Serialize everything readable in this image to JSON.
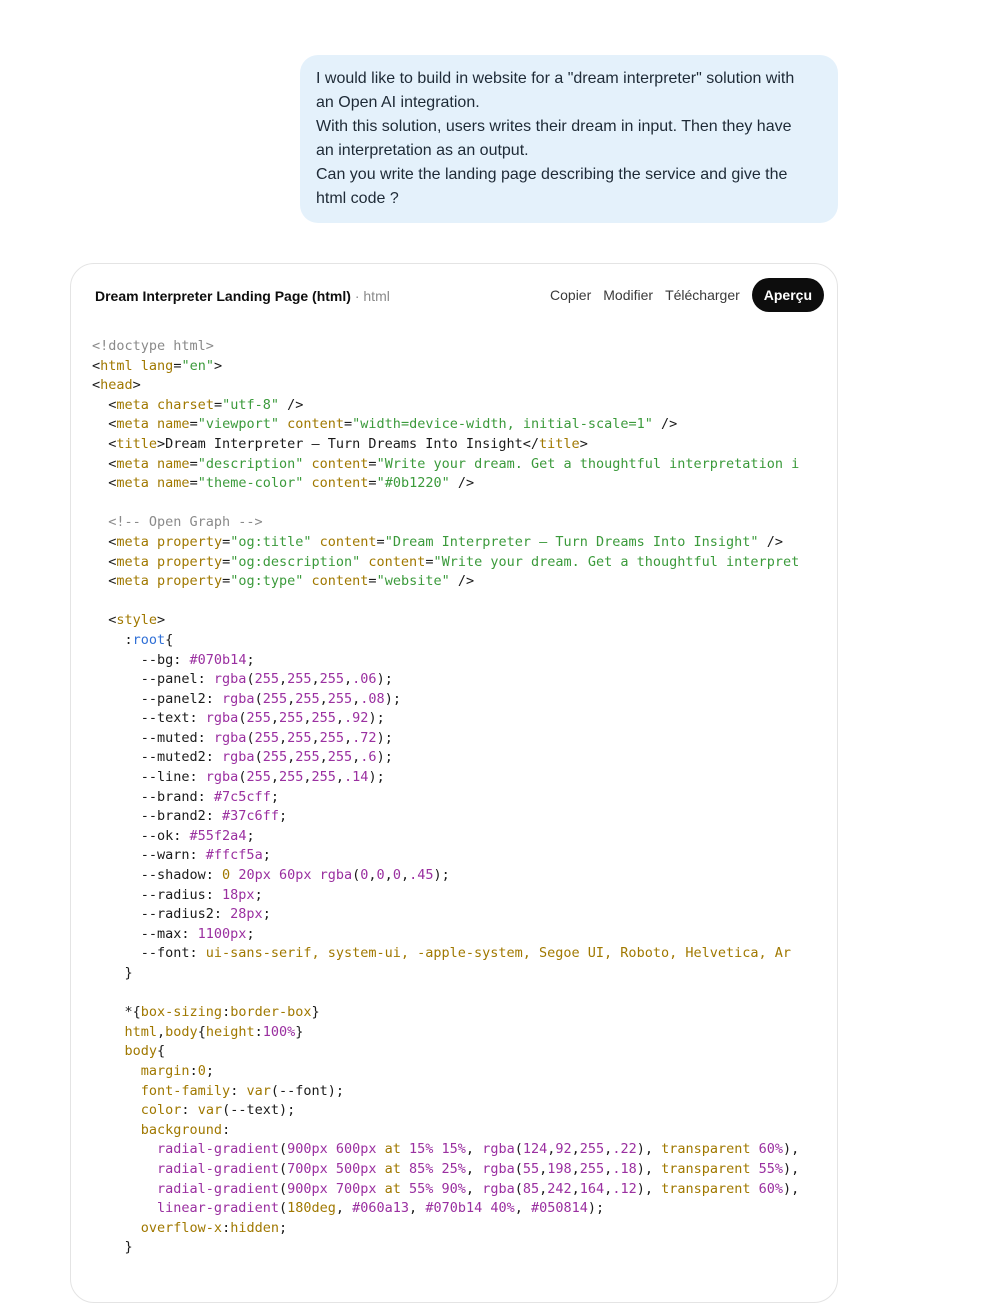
{
  "user_message": {
    "lines": [
      "I would like to build in website for a \"dream interpreter\" solution with",
      "an Open AI integration.",
      "With this solution, users writes their dream in input. Then they have",
      "an interpretation as an output.",
      "Can you write the landing page describing the service and give the",
      "html code ?"
    ]
  },
  "code_card": {
    "title": "Dream Interpreter Landing Page (html)",
    "separator": " · ",
    "language": "html",
    "actions": {
      "copy": "Copier",
      "edit": "Modifier",
      "download": "Télécharger",
      "preview": "Aperçu"
    }
  },
  "code_lines": [
    [
      [
        "com",
        "<!doctype html>"
      ]
    ],
    [
      [
        "plain",
        "<"
      ],
      [
        "tag",
        "html"
      ],
      [
        "plain",
        " "
      ],
      [
        "attr",
        "lang"
      ],
      [
        "plain",
        "="
      ],
      [
        "str",
        "\"en\""
      ],
      [
        "plain",
        ">"
      ]
    ],
    [
      [
        "plain",
        "<"
      ],
      [
        "tag",
        "head"
      ],
      [
        "plain",
        ">"
      ]
    ],
    [
      [
        "plain",
        "  <"
      ],
      [
        "tag",
        "meta"
      ],
      [
        "plain",
        " "
      ],
      [
        "attr",
        "charset"
      ],
      [
        "plain",
        "="
      ],
      [
        "str",
        "\"utf-8\""
      ],
      [
        "plain",
        " />"
      ]
    ],
    [
      [
        "plain",
        "  <"
      ],
      [
        "tag",
        "meta"
      ],
      [
        "plain",
        " "
      ],
      [
        "attr",
        "name"
      ],
      [
        "plain",
        "="
      ],
      [
        "str",
        "\"viewport\""
      ],
      [
        "plain",
        " "
      ],
      [
        "attr",
        "content"
      ],
      [
        "plain",
        "="
      ],
      [
        "str",
        "\"width=device-width, initial-scale=1\""
      ],
      [
        "plain",
        " />"
      ]
    ],
    [
      [
        "plain",
        "  <"
      ],
      [
        "tag",
        "title"
      ],
      [
        "plain",
        ">Dream Interpreter — Turn Dreams Into Insight</"
      ],
      [
        "tag",
        "title"
      ],
      [
        "plain",
        ">"
      ]
    ],
    [
      [
        "plain",
        "  <"
      ],
      [
        "tag",
        "meta"
      ],
      [
        "plain",
        " "
      ],
      [
        "attr",
        "name"
      ],
      [
        "plain",
        "="
      ],
      [
        "str",
        "\"description\""
      ],
      [
        "plain",
        " "
      ],
      [
        "attr",
        "content"
      ],
      [
        "plain",
        "="
      ],
      [
        "str",
        "\"Write your dream. Get a thoughtful interpretation i"
      ]
    ],
    [
      [
        "plain",
        "  <"
      ],
      [
        "tag",
        "meta"
      ],
      [
        "plain",
        " "
      ],
      [
        "attr",
        "name"
      ],
      [
        "plain",
        "="
      ],
      [
        "str",
        "\"theme-color\""
      ],
      [
        "plain",
        " "
      ],
      [
        "attr",
        "content"
      ],
      [
        "plain",
        "="
      ],
      [
        "str",
        "\"#0b1220\""
      ],
      [
        "plain",
        " />"
      ]
    ],
    [],
    [
      [
        "com",
        "  <!-- Open Graph -->"
      ]
    ],
    [
      [
        "plain",
        "  <"
      ],
      [
        "tag",
        "meta"
      ],
      [
        "plain",
        " "
      ],
      [
        "attr",
        "property"
      ],
      [
        "plain",
        "="
      ],
      [
        "str",
        "\"og:title\""
      ],
      [
        "plain",
        " "
      ],
      [
        "attr",
        "content"
      ],
      [
        "plain",
        "="
      ],
      [
        "str",
        "\"Dream Interpreter — Turn Dreams Into Insight\""
      ],
      [
        "plain",
        " />"
      ]
    ],
    [
      [
        "plain",
        "  <"
      ],
      [
        "tag",
        "meta"
      ],
      [
        "plain",
        " "
      ],
      [
        "attr",
        "property"
      ],
      [
        "plain",
        "="
      ],
      [
        "str",
        "\"og:description\""
      ],
      [
        "plain",
        " "
      ],
      [
        "attr",
        "content"
      ],
      [
        "plain",
        "="
      ],
      [
        "str",
        "\"Write your dream. Get a thoughtful interpret"
      ]
    ],
    [
      [
        "plain",
        "  <"
      ],
      [
        "tag",
        "meta"
      ],
      [
        "plain",
        " "
      ],
      [
        "attr",
        "property"
      ],
      [
        "plain",
        "="
      ],
      [
        "str",
        "\"og:type\""
      ],
      [
        "plain",
        " "
      ],
      [
        "attr",
        "content"
      ],
      [
        "plain",
        "="
      ],
      [
        "str",
        "\"website\""
      ],
      [
        "plain",
        " />"
      ]
    ],
    [],
    [
      [
        "plain",
        "  <"
      ],
      [
        "tag",
        "style"
      ],
      [
        "plain",
        ">"
      ]
    ],
    [
      [
        "plain",
        "    :"
      ],
      [
        "key",
        "root"
      ],
      [
        "plain",
        "{"
      ]
    ],
    [
      [
        "plain",
        "      --bg: "
      ],
      [
        "num",
        "#070b14"
      ],
      [
        "plain",
        ";"
      ]
    ],
    [
      [
        "plain",
        "      --panel: "
      ],
      [
        "num",
        "rgba"
      ],
      [
        "plain",
        "("
      ],
      [
        "num",
        "255"
      ],
      [
        "plain",
        ","
      ],
      [
        "num",
        "255"
      ],
      [
        "plain",
        ","
      ],
      [
        "num",
        "255"
      ],
      [
        "plain",
        ","
      ],
      [
        "num",
        ".06"
      ],
      [
        "plain",
        ");"
      ]
    ],
    [
      [
        "plain",
        "      --panel2: "
      ],
      [
        "num",
        "rgba"
      ],
      [
        "plain",
        "("
      ],
      [
        "num",
        "255"
      ],
      [
        "plain",
        ","
      ],
      [
        "num",
        "255"
      ],
      [
        "plain",
        ","
      ],
      [
        "num",
        "255"
      ],
      [
        "plain",
        ","
      ],
      [
        "num",
        ".08"
      ],
      [
        "plain",
        ");"
      ]
    ],
    [
      [
        "plain",
        "      --text: "
      ],
      [
        "num",
        "rgba"
      ],
      [
        "plain",
        "("
      ],
      [
        "num",
        "255"
      ],
      [
        "plain",
        ","
      ],
      [
        "num",
        "255"
      ],
      [
        "plain",
        ","
      ],
      [
        "num",
        "255"
      ],
      [
        "plain",
        ","
      ],
      [
        "num",
        ".92"
      ],
      [
        "plain",
        ");"
      ]
    ],
    [
      [
        "plain",
        "      --muted: "
      ],
      [
        "num",
        "rgba"
      ],
      [
        "plain",
        "("
      ],
      [
        "num",
        "255"
      ],
      [
        "plain",
        ","
      ],
      [
        "num",
        "255"
      ],
      [
        "plain",
        ","
      ],
      [
        "num",
        "255"
      ],
      [
        "plain",
        ","
      ],
      [
        "num",
        ".72"
      ],
      [
        "plain",
        ");"
      ]
    ],
    [
      [
        "plain",
        "      --muted2: "
      ],
      [
        "num",
        "rgba"
      ],
      [
        "plain",
        "("
      ],
      [
        "num",
        "255"
      ],
      [
        "plain",
        ","
      ],
      [
        "num",
        "255"
      ],
      [
        "plain",
        ","
      ],
      [
        "num",
        "255"
      ],
      [
        "plain",
        ","
      ],
      [
        "num",
        ".6"
      ],
      [
        "plain",
        ");"
      ]
    ],
    [
      [
        "plain",
        "      --line: "
      ],
      [
        "num",
        "rgba"
      ],
      [
        "plain",
        "("
      ],
      [
        "num",
        "255"
      ],
      [
        "plain",
        ","
      ],
      [
        "num",
        "255"
      ],
      [
        "plain",
        ","
      ],
      [
        "num",
        "255"
      ],
      [
        "plain",
        ","
      ],
      [
        "num",
        ".14"
      ],
      [
        "plain",
        ");"
      ]
    ],
    [
      [
        "plain",
        "      --brand: "
      ],
      [
        "num",
        "#7c5cff"
      ],
      [
        "plain",
        ";"
      ]
    ],
    [
      [
        "plain",
        "      --brand2: "
      ],
      [
        "num",
        "#37c6ff"
      ],
      [
        "plain",
        ";"
      ]
    ],
    [
      [
        "plain",
        "      --ok: "
      ],
      [
        "num",
        "#55f2a4"
      ],
      [
        "plain",
        ";"
      ]
    ],
    [
      [
        "plain",
        "      --warn: "
      ],
      [
        "num",
        "#ffcf5a"
      ],
      [
        "plain",
        ";"
      ]
    ],
    [
      [
        "plain",
        "      --shadow: "
      ],
      [
        "tag",
        "0 "
      ],
      [
        "num",
        "20px 60px rgba"
      ],
      [
        "plain",
        "("
      ],
      [
        "num",
        "0"
      ],
      [
        "plain",
        ","
      ],
      [
        "num",
        "0"
      ],
      [
        "plain",
        ","
      ],
      [
        "num",
        "0"
      ],
      [
        "plain",
        ","
      ],
      [
        "num",
        ".45"
      ],
      [
        "plain",
        ");"
      ]
    ],
    [
      [
        "plain",
        "      --radius: "
      ],
      [
        "num",
        "18px"
      ],
      [
        "plain",
        ";"
      ]
    ],
    [
      [
        "plain",
        "      --radius2: "
      ],
      [
        "num",
        "28px"
      ],
      [
        "plain",
        ";"
      ]
    ],
    [
      [
        "plain",
        "      --max: "
      ],
      [
        "num",
        "1100px"
      ],
      [
        "plain",
        ";"
      ]
    ],
    [
      [
        "plain",
        "      --font: "
      ],
      [
        "tag",
        "ui-sans-serif, system-ui, -apple-system, Segoe UI, Roboto, Helvetica, Ar"
      ]
    ],
    [
      [
        "plain",
        "    }"
      ]
    ],
    [],
    [
      [
        "plain",
        "    *{"
      ],
      [
        "tag",
        "box-sizing"
      ],
      [
        "plain",
        ":"
      ],
      [
        "tag",
        "border-box"
      ],
      [
        "plain",
        "}"
      ]
    ],
    [
      [
        "plain",
        "    "
      ],
      [
        "tag",
        "html"
      ],
      [
        "plain",
        ","
      ],
      [
        "tag",
        "body"
      ],
      [
        "plain",
        "{"
      ],
      [
        "tag",
        "height"
      ],
      [
        "plain",
        ":"
      ],
      [
        "num",
        "100%"
      ],
      [
        "plain",
        "}"
      ]
    ],
    [
      [
        "plain",
        "    "
      ],
      [
        "tag",
        "body"
      ],
      [
        "plain",
        "{"
      ]
    ],
    [
      [
        "plain",
        "      "
      ],
      [
        "tag",
        "margin"
      ],
      [
        "plain",
        ":"
      ],
      [
        "tag",
        "0"
      ],
      [
        "plain",
        ";"
      ]
    ],
    [
      [
        "plain",
        "      "
      ],
      [
        "tag",
        "font-family"
      ],
      [
        "plain",
        ": "
      ],
      [
        "tag",
        "var"
      ],
      [
        "plain",
        "(--font);"
      ]
    ],
    [
      [
        "plain",
        "      "
      ],
      [
        "tag",
        "color"
      ],
      [
        "plain",
        ": "
      ],
      [
        "tag",
        "var"
      ],
      [
        "plain",
        "(--text);"
      ]
    ],
    [
      [
        "plain",
        "      "
      ],
      [
        "tag",
        "background"
      ],
      [
        "plain",
        ":"
      ]
    ],
    [
      [
        "plain",
        "        "
      ],
      [
        "num",
        "radial-gradient"
      ],
      [
        "plain",
        "("
      ],
      [
        "num",
        "900px 600px"
      ],
      [
        "tag",
        " at "
      ],
      [
        "num",
        "15% 15%"
      ],
      [
        "plain",
        ", "
      ],
      [
        "num",
        "rgba"
      ],
      [
        "plain",
        "("
      ],
      [
        "num",
        "124"
      ],
      [
        "plain",
        ","
      ],
      [
        "num",
        "92"
      ],
      [
        "plain",
        ","
      ],
      [
        "num",
        "255"
      ],
      [
        "plain",
        ","
      ],
      [
        "num",
        ".22"
      ],
      [
        "plain",
        "), "
      ],
      [
        "tag",
        "transparent "
      ],
      [
        "num",
        "60%"
      ],
      [
        "plain",
        "),"
      ]
    ],
    [
      [
        "plain",
        "        "
      ],
      [
        "num",
        "radial-gradient"
      ],
      [
        "plain",
        "("
      ],
      [
        "num",
        "700px 500px"
      ],
      [
        "tag",
        " at "
      ],
      [
        "num",
        "85% 25%"
      ],
      [
        "plain",
        ", "
      ],
      [
        "num",
        "rgba"
      ],
      [
        "plain",
        "("
      ],
      [
        "num",
        "55"
      ],
      [
        "plain",
        ","
      ],
      [
        "num",
        "198"
      ],
      [
        "plain",
        ","
      ],
      [
        "num",
        "255"
      ],
      [
        "plain",
        ","
      ],
      [
        "num",
        ".18"
      ],
      [
        "plain",
        "), "
      ],
      [
        "tag",
        "transparent "
      ],
      [
        "num",
        "55%"
      ],
      [
        "plain",
        "),"
      ]
    ],
    [
      [
        "plain",
        "        "
      ],
      [
        "num",
        "radial-gradient"
      ],
      [
        "plain",
        "("
      ],
      [
        "num",
        "900px 700px"
      ],
      [
        "tag",
        " at "
      ],
      [
        "num",
        "55% 90%"
      ],
      [
        "plain",
        ", "
      ],
      [
        "num",
        "rgba"
      ],
      [
        "plain",
        "("
      ],
      [
        "num",
        "85"
      ],
      [
        "plain",
        ","
      ],
      [
        "num",
        "242"
      ],
      [
        "plain",
        ","
      ],
      [
        "num",
        "164"
      ],
      [
        "plain",
        ","
      ],
      [
        "num",
        ".12"
      ],
      [
        "plain",
        "), "
      ],
      [
        "tag",
        "transparent "
      ],
      [
        "num",
        "60%"
      ],
      [
        "plain",
        "),"
      ]
    ],
    [
      [
        "plain",
        "        "
      ],
      [
        "num",
        "linear-gradient"
      ],
      [
        "plain",
        "("
      ],
      [
        "tag",
        "180deg"
      ],
      [
        "plain",
        ", "
      ],
      [
        "num",
        "#060a13"
      ],
      [
        "plain",
        ", "
      ],
      [
        "num",
        "#070b14 40%"
      ],
      [
        "plain",
        ", "
      ],
      [
        "num",
        "#050814"
      ],
      [
        "plain",
        ");"
      ]
    ],
    [
      [
        "plain",
        "      "
      ],
      [
        "tag",
        "overflow-x"
      ],
      [
        "plain",
        ":"
      ],
      [
        "tag",
        "hidden"
      ],
      [
        "plain",
        ";"
      ]
    ],
    [
      [
        "plain",
        "    }"
      ]
    ]
  ]
}
